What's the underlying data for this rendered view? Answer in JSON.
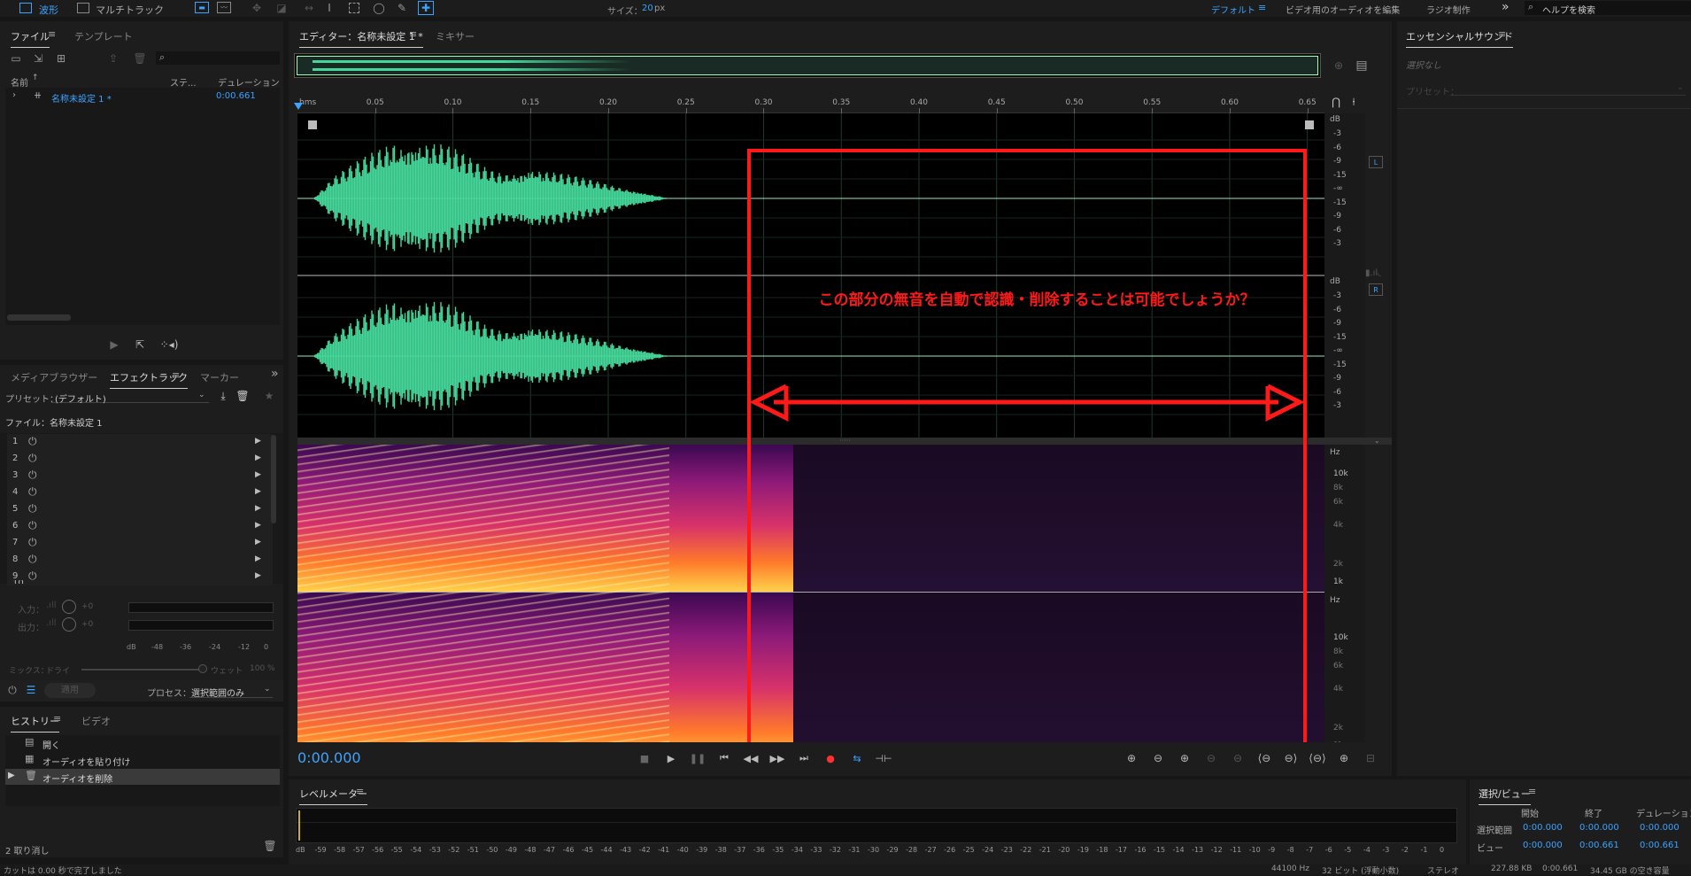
{
  "topbar": {
    "waveform_tab": "波形",
    "multitrack_tab": "マルチトラック",
    "size_label": "サイズ：",
    "size_value": "20",
    "size_unit": "px",
    "workspaces": [
      "デフォルト",
      "ビデオ用のオーディオを編集",
      "ラジオ制作"
    ],
    "more": "»",
    "help_placeholder": "ヘルプを検索"
  },
  "files": {
    "tabs": [
      "ファイル",
      "テンプレート"
    ],
    "col_name": "名前",
    "col_status": "ステ...",
    "col_duration": "デュレーション",
    "items": [
      {
        "name": "名称未設定 1 *",
        "duration": "0:00.661"
      }
    ]
  },
  "effects": {
    "tabs": [
      "メディアブラウザー",
      "エフェクトラック",
      "マーカー"
    ],
    "more": "»",
    "preset_label": "プリセット：",
    "preset_value": "(デフォルト)",
    "file_label": "ファイル：名称未設定 1",
    "slots": [
      "1",
      "2",
      "3",
      "4",
      "5",
      "6",
      "7",
      "8",
      "9",
      "10"
    ],
    "input_label": "入力：",
    "output_label": "出力：",
    "io_value": "+0",
    "scale": [
      "dB",
      "-48",
      "-36",
      "-24",
      "-12",
      "0"
    ],
    "mix_label": "ミックス：",
    "mix_dry": "ドライ",
    "mix_wet": "ウェット",
    "mix_pct": "100 %",
    "apply": "適用",
    "process_label": "プロセス：",
    "process_value": "選択範囲のみ"
  },
  "history": {
    "tabs": [
      "ヒストリー",
      "ビデオ"
    ],
    "items": [
      "開く",
      "オーディオを貼り付け",
      "オーディオを削除"
    ],
    "undo_count": "2 取り消し"
  },
  "editor": {
    "tabs": [
      "エディター：名称未設定 1 *",
      "ミキサー"
    ],
    "ruler_unit": "hms",
    "ruler": [
      "0.05",
      "0.10",
      "0.15",
      "0.20",
      "0.25",
      "0.30",
      "0.35",
      "0.40",
      "0.45",
      "0.50",
      "0.55",
      "0.60",
      "0.65"
    ],
    "db_unit": "dB",
    "db_ticks": [
      "-3",
      "-6",
      "-9",
      "-15",
      "-∞",
      "-15",
      "-9",
      "-6",
      "-3"
    ],
    "hz_unit": "Hz",
    "hz_ticks": [
      "10k",
      "8k",
      "6k",
      "4k",
      "2k",
      "1k"
    ],
    "ch_left": "L",
    "ch_right": "R",
    "annotation": "この部分の無音を自動で認識・削除することは可能でしょうか？",
    "time": "0:00.000"
  },
  "transport": [
    "■",
    "▶",
    "❚❚",
    "⏮",
    "◀◀",
    "▶▶",
    "⏭",
    "●",
    "⇆",
    "⊣⊢"
  ],
  "essential": {
    "title": "エッセンシャルサウンド",
    "none": "選択なし",
    "preset": "プリセット："
  },
  "levels": {
    "title": "レベルメーター",
    "scale": [
      "dB",
      "-59",
      "-58",
      "-57",
      "-56",
      "-55",
      "-54",
      "-53",
      "-52",
      "-51",
      "-50",
      "-49",
      "-48",
      "-47",
      "-46",
      "-45",
      "-44",
      "-43",
      "-42",
      "-41",
      "-40",
      "-39",
      "-38",
      "-37",
      "-36",
      "-35",
      "-34",
      "-33",
      "-32",
      "-31",
      "-30",
      "-29",
      "-28",
      "-27",
      "-26",
      "-25",
      "-24",
      "-23",
      "-22",
      "-21",
      "-20",
      "-19",
      "-18",
      "-17",
      "-16",
      "-15",
      "-14",
      "-13",
      "-12",
      "-11",
      "-10",
      "-9",
      "-8",
      "-7",
      "-6",
      "-5",
      "-4",
      "-3",
      "-2",
      "-1",
      "0"
    ]
  },
  "selection": {
    "title": "選択/ビュー",
    "cols": [
      "開始",
      "終了",
      "デュレーション"
    ],
    "rows": [
      {
        "label": "選択範囲",
        "v": [
          "0:00.000",
          "0:00.000",
          "0:00.000"
        ]
      },
      {
        "label": "ビュー",
        "v": [
          "0:00.000",
          "0:00.661",
          "0:00.661"
        ]
      }
    ]
  },
  "status": {
    "left": "カットは 0.00 秒で完了しました",
    "right": [
      "44100 Hz",
      "32 ビット (浮動小数)",
      "ステレオ",
      "227.88 KB",
      "0:00.661",
      "34.45 GB の空き容量"
    ]
  },
  "colors": {
    "wave": "#45d79a",
    "annotation": "#ff1a1a",
    "accent": "#3ea3ff"
  }
}
